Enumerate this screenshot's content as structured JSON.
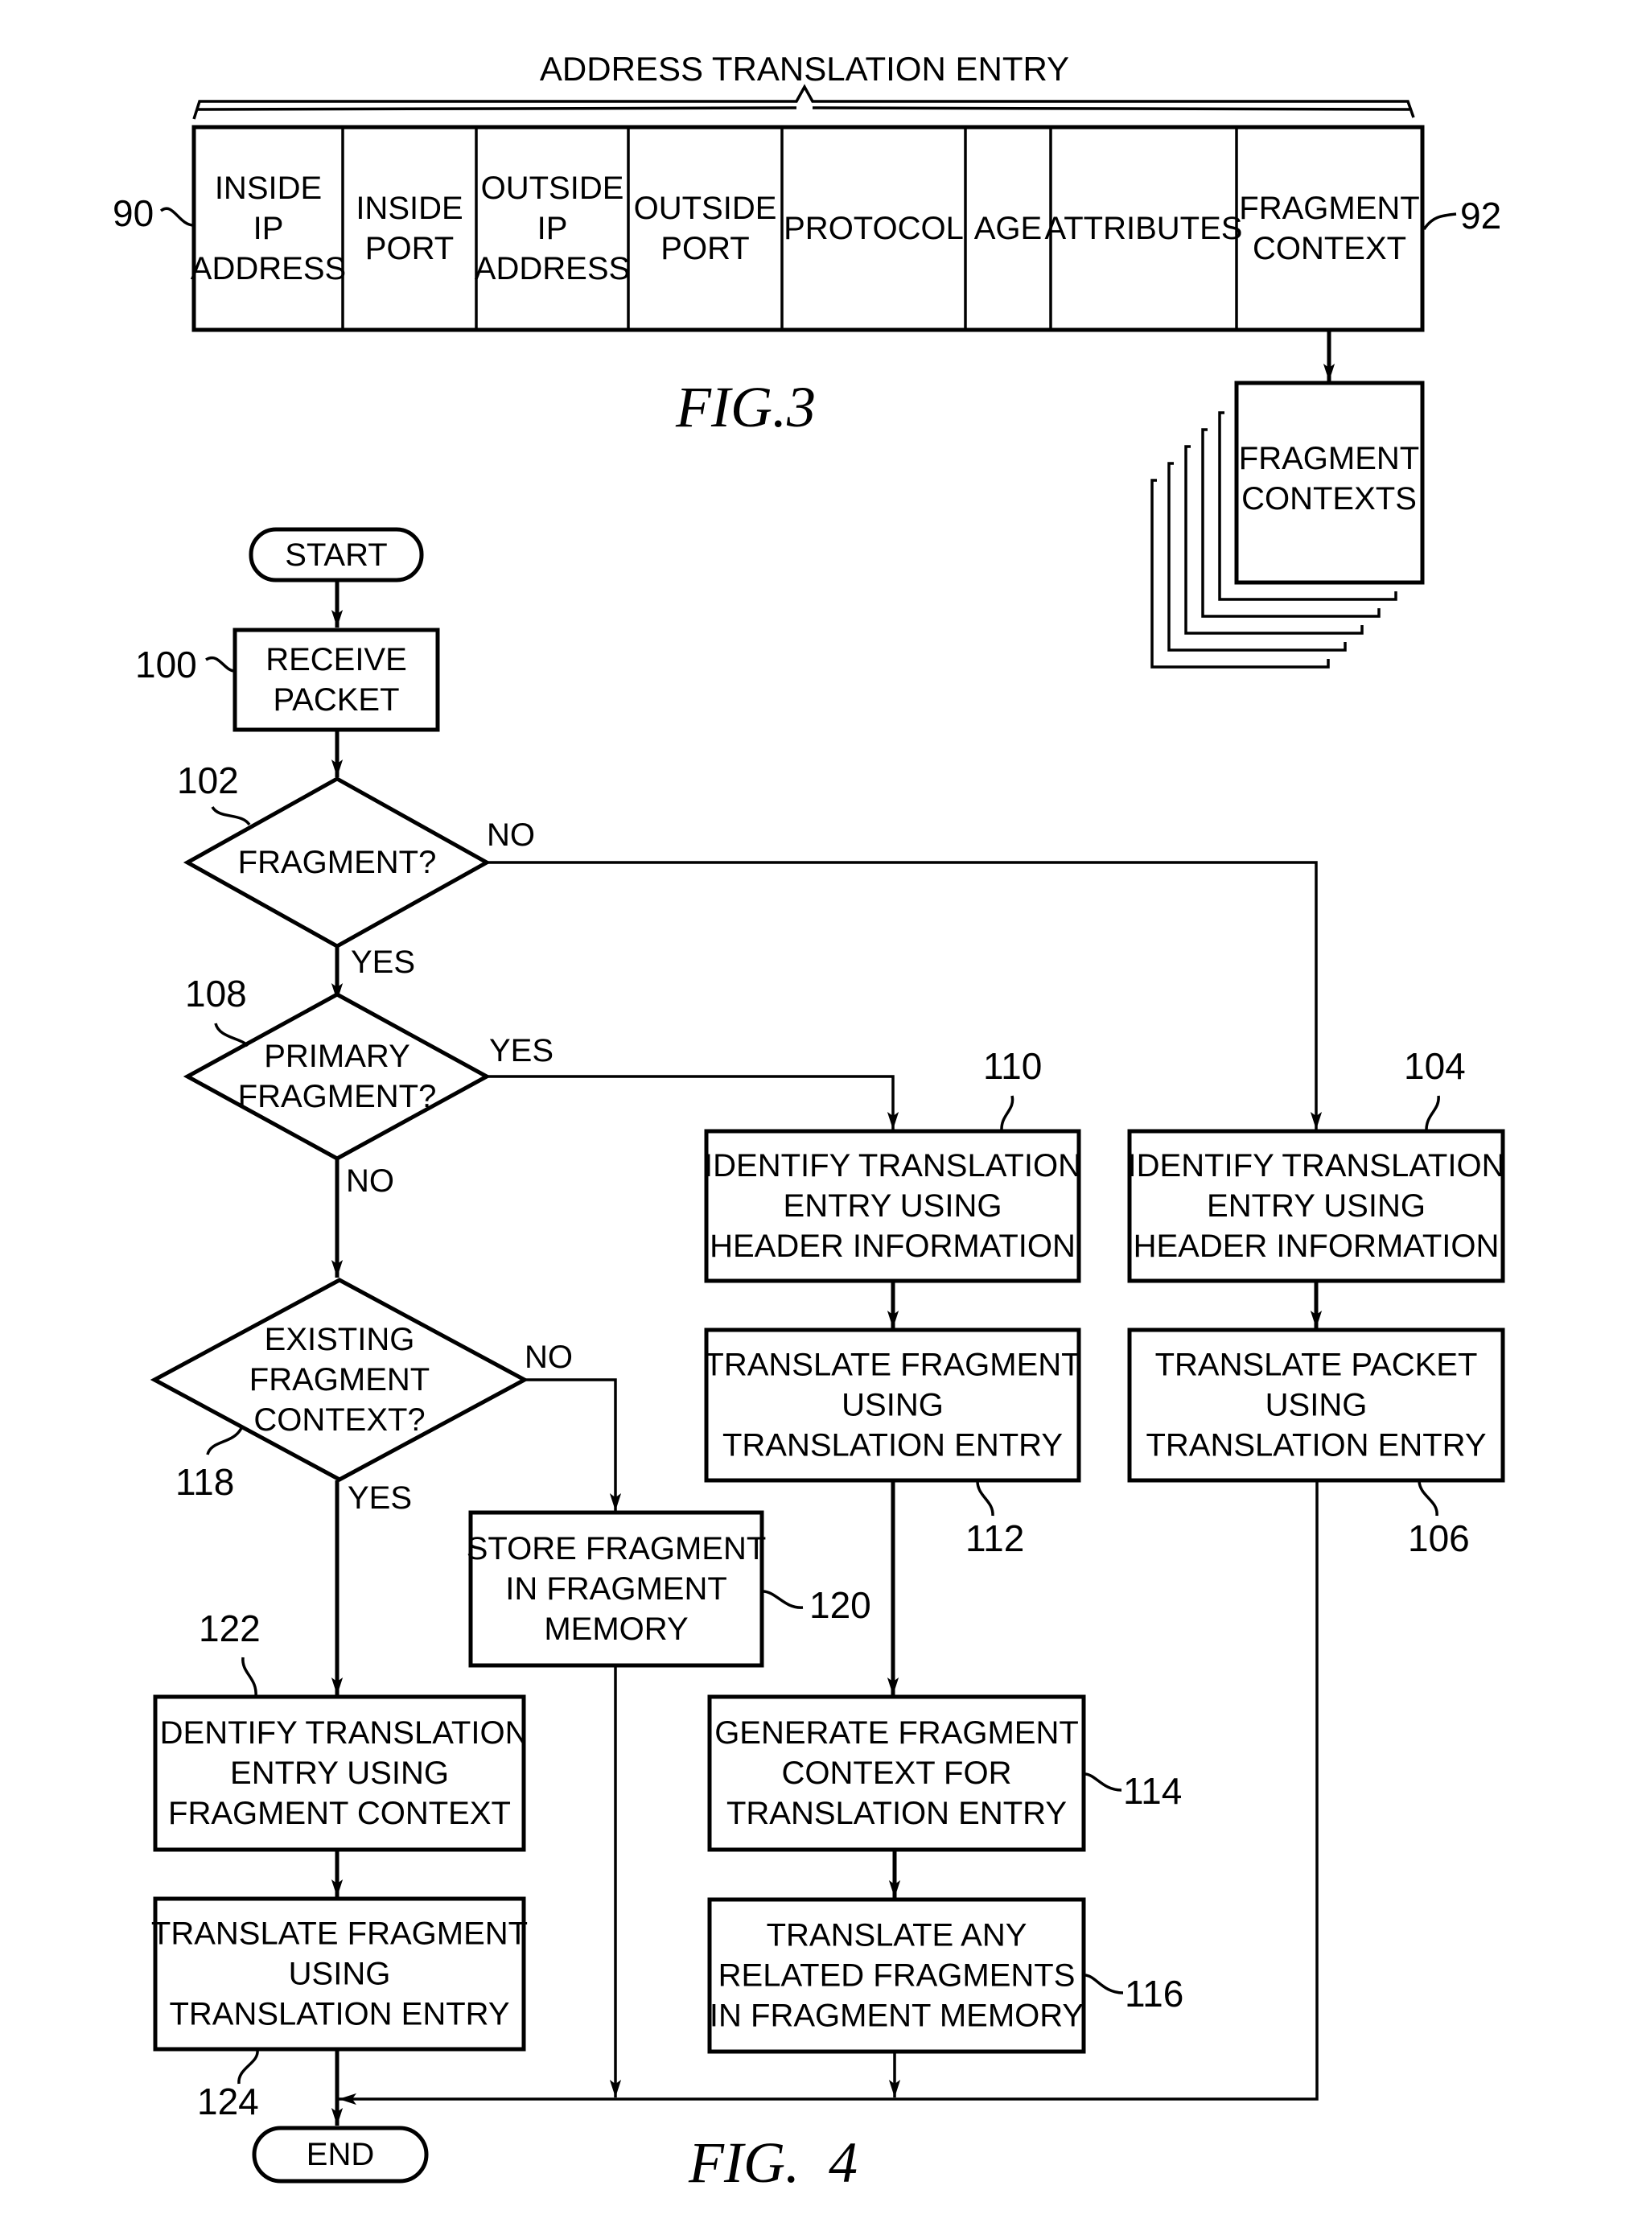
{
  "fig3": {
    "caption": "FIG.3",
    "entry_title": "ADDRESS TRANSLATION ENTRY",
    "entry_ref": "90",
    "fragment_context_ref": "92",
    "fields": [
      {
        "lines": [
          "INSIDE",
          "IP",
          "ADDRESS"
        ]
      },
      {
        "lines": [
          "INSIDE",
          "PORT"
        ]
      },
      {
        "lines": [
          "OUTSIDE",
          "IP",
          "ADDRESS"
        ]
      },
      {
        "lines": [
          "OUTSIDE",
          "PORT"
        ]
      },
      {
        "lines": [
          "PROTOCOL"
        ]
      },
      {
        "lines": [
          "AGE"
        ]
      },
      {
        "lines": [
          "ATTRIBUTES"
        ]
      },
      {
        "lines": [
          "FRAGMENT",
          "CONTEXT"
        ]
      }
    ],
    "fragment_contexts": {
      "lines": [
        "FRAGMENT",
        "CONTEXTS"
      ]
    }
  },
  "fig4": {
    "caption": "FIG.  4",
    "start": "START",
    "end": "END",
    "nodes": {
      "n100": {
        "ref": "100",
        "lines": [
          "RECEIVE",
          "PACKET"
        ]
      },
      "n102": {
        "ref": "102",
        "lines": [
          "FRAGMENT?"
        ]
      },
      "n108": {
        "ref": "108",
        "lines": [
          "PRIMARY",
          "FRAGMENT?"
        ]
      },
      "n118": {
        "ref": "118",
        "lines": [
          "EXISTING",
          "FRAGMENT",
          "CONTEXT?"
        ]
      },
      "n110": {
        "ref": "110",
        "lines": [
          "IDENTIFY TRANSLATION",
          "ENTRY USING",
          "HEADER INFORMATION"
        ]
      },
      "n112": {
        "ref": "112",
        "lines": [
          "TRANSLATE FRAGMENT",
          "USING",
          "TRANSLATION ENTRY"
        ]
      },
      "n104": {
        "ref": "104",
        "lines": [
          "IDENTIFY TRANSLATION",
          "ENTRY USING",
          "HEADER INFORMATION"
        ]
      },
      "n106": {
        "ref": "106",
        "lines": [
          "TRANSLATE PACKET",
          "USING",
          "TRANSLATION ENTRY"
        ]
      },
      "n120": {
        "ref": "120",
        "lines": [
          "STORE FRAGMENT",
          "IN FRAGMENT",
          "MEMORY"
        ]
      },
      "n114": {
        "ref": "114",
        "lines": [
          "GENERATE FRAGMENT",
          "CONTEXT FOR",
          "TRANSLATION ENTRY"
        ]
      },
      "n116": {
        "ref": "116",
        "lines": [
          "TRANSLATE ANY",
          "RELATED FRAGMENTS",
          "IN FRAGMENT MEMORY"
        ]
      },
      "n122": {
        "ref": "122",
        "lines": [
          "IDENTIFY TRANSLATION",
          "ENTRY USING",
          "FRAGMENT CONTEXT"
        ]
      },
      "n124": {
        "ref": "124",
        "lines": [
          "TRANSLATE FRAGMENT",
          "USING",
          "TRANSLATION ENTRY"
        ]
      }
    },
    "edge_labels": {
      "n102_no": "NO",
      "n102_yes": "YES",
      "n108_yes": "YES",
      "n108_no": "NO",
      "n118_no": "NO",
      "n118_yes": "YES"
    }
  }
}
